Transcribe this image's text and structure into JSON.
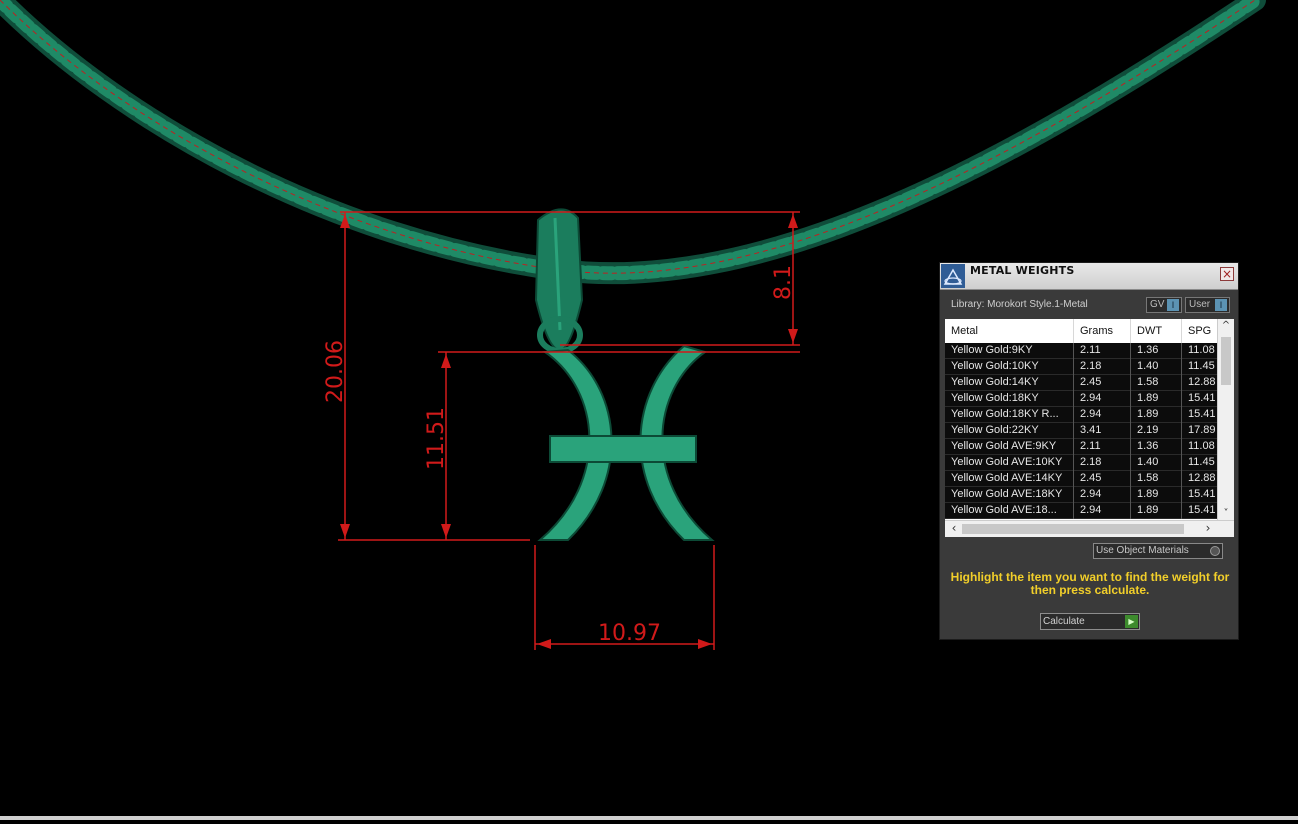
{
  "viewport": {
    "dimensions": {
      "overall_height": "20.06",
      "pendant_height": "11.51",
      "pendant_width": "10.97",
      "bail_height": "8.1"
    }
  },
  "panel": {
    "title": "METAL WEIGHTS",
    "library_label": "Library: Morokort Style.1-Metal",
    "toggles": {
      "gv": "GV",
      "user": "User"
    },
    "columns": [
      "Metal",
      "Grams",
      "DWT",
      "SPG"
    ],
    "rows": [
      {
        "metal": "Yellow Gold:9KY",
        "grams": "2.11",
        "dwt": "1.36",
        "spg": "11.08"
      },
      {
        "metal": "Yellow Gold:10KY",
        "grams": "2.18",
        "dwt": "1.40",
        "spg": "11.45"
      },
      {
        "metal": "Yellow Gold:14KY",
        "grams": "2.45",
        "dwt": "1.58",
        "spg": "12.88"
      },
      {
        "metal": "Yellow Gold:18KY",
        "grams": "2.94",
        "dwt": "1.89",
        "spg": "15.41"
      },
      {
        "metal": "Yellow Gold:18KY R...",
        "grams": "2.94",
        "dwt": "1.89",
        "spg": "15.41"
      },
      {
        "metal": "Yellow Gold:22KY",
        "grams": "3.41",
        "dwt": "2.19",
        "spg": "17.89"
      },
      {
        "metal": "Yellow Gold AVE:9KY",
        "grams": "2.11",
        "dwt": "1.36",
        "spg": "11.08"
      },
      {
        "metal": "Yellow Gold AVE:10KY",
        "grams": "2.18",
        "dwt": "1.40",
        "spg": "11.45"
      },
      {
        "metal": "Yellow Gold AVE:14KY",
        "grams": "2.45",
        "dwt": "1.58",
        "spg": "12.88"
      },
      {
        "metal": "Yellow Gold AVE:18KY",
        "grams": "2.94",
        "dwt": "1.89",
        "spg": "15.41"
      },
      {
        "metal": "Yellow Gold AVE:18...",
        "grams": "2.94",
        "dwt": "1.89",
        "spg": "15.41"
      }
    ],
    "use_object_materials_label": "Use Object Materials",
    "hint": "Highlight the item you want to find the weight for then press calculate.",
    "calculate_label": "Calculate",
    "colors": {
      "hint": "#f2cf2a",
      "dimension": "#d11a1a",
      "metal_model": "#1f8a66"
    }
  }
}
